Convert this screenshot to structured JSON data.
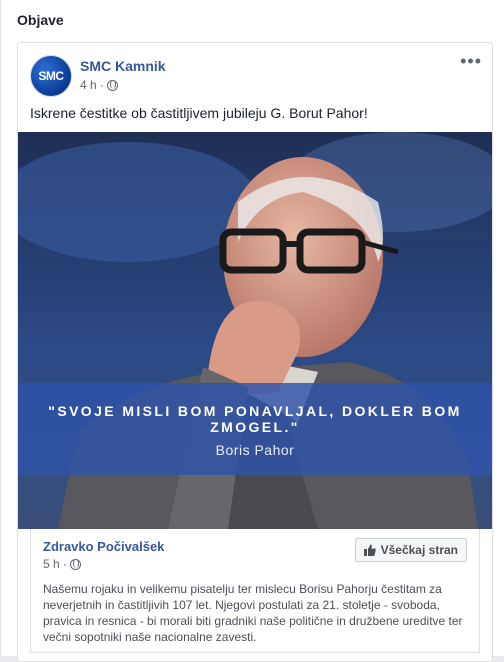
{
  "section": {
    "title": "Objave"
  },
  "post": {
    "page_name": "SMC Kamnik",
    "avatar_text": "SMC",
    "time": "4 h",
    "separator": "·",
    "text": "Iskrene čestitke ob častitljivem jubileju G. Borut Pahor!",
    "more_label": "•••"
  },
  "image": {
    "quote": "\"SVOJE MISLI BOM PONAVLJAL, DOKLER BOM ZMOGEL.\"",
    "author": "Boris Pahor"
  },
  "shared": {
    "author": "Zdravko Počivalšek",
    "time": "5 h",
    "separator": "·",
    "like_button": "Všečkaj stran",
    "text": "Našemu rojaku in velikemu pisatelju ter mislecu Borisu Pahorju čestitam za neverjetnih in častitljivih 107 let. Njegovi postulati za 21. stoletje - svoboda, pravica in resnica - bi morali biti gradniki naše politične in družbene ureditve ter večni sopotniki naše nacionalne zavesti."
  },
  "colors": {
    "link": "#365899",
    "banner": "#2e53aa",
    "text": "#1d2129"
  }
}
